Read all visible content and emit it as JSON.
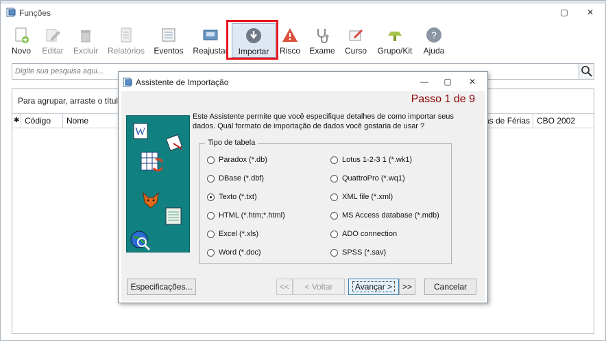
{
  "window": {
    "title": "Funções",
    "controls": [
      "▢",
      "✕"
    ]
  },
  "toolbar": {
    "buttons": [
      {
        "label": "Novo",
        "icon": "new-icon",
        "enabled": true
      },
      {
        "label": "Editar",
        "icon": "edit-icon",
        "enabled": false
      },
      {
        "label": "Excluir",
        "icon": "delete-icon",
        "enabled": false
      },
      {
        "label": "Relatórios",
        "icon": "report-icon",
        "enabled": false
      },
      {
        "label": "Eventos",
        "icon": "events-icon",
        "enabled": true
      },
      {
        "label": "Reajustar",
        "icon": "adjust-icon",
        "enabled": true
      },
      {
        "label": "Importar",
        "icon": "import-icon",
        "enabled": true,
        "active": true
      },
      {
        "label": "Risco",
        "icon": "warning-icon",
        "enabled": true
      },
      {
        "label": "Exame",
        "icon": "stethoscope-icon",
        "enabled": true
      },
      {
        "label": "Curso",
        "icon": "course-icon",
        "enabled": true
      },
      {
        "label": "Grupo/Kit",
        "icon": "group-icon",
        "enabled": true
      },
      {
        "label": "Ajuda",
        "icon": "help-icon",
        "enabled": true
      }
    ]
  },
  "search": {
    "placeholder": "Digite sua pesquisa aqui..."
  },
  "grid": {
    "group_hint": "Para agrupar, arraste o título",
    "columns": [
      "✱",
      "Código",
      "Nome",
      "as de Férias",
      "CBO 2002"
    ]
  },
  "dialog": {
    "title": "Assistente de Importação",
    "controls": [
      "—",
      "▢",
      "✕"
    ],
    "step": "Passo 1 de 9",
    "intro": "Este Assistente permite que você especifique detalhes de como importar seus dados. Qual formato de importação de dados você gostaria de usar ?",
    "group_title": "Tipo de tabela",
    "options_left": [
      {
        "label": "Paradox (*.db)",
        "checked": false
      },
      {
        "label": "DBase (*.dbf)",
        "checked": false
      },
      {
        "label": "Texto (*.txt)",
        "checked": true
      },
      {
        "label": "HTML (*.htm;*.html)",
        "checked": false
      },
      {
        "label": "Excel (*.xls)",
        "checked": false
      },
      {
        "label": "Word (*.doc)",
        "checked": false
      }
    ],
    "options_right": [
      {
        "label": "Lotus 1-2-3 1 (*.wk1)",
        "checked": false
      },
      {
        "label": "QuattroPro (*.wq1)",
        "checked": false
      },
      {
        "label": "XML file (*.xml)",
        "checked": false
      },
      {
        "label": "MS Access database (*.mdb)",
        "checked": false
      },
      {
        "label": "ADO connection",
        "checked": false
      },
      {
        "label": "SPSS (*.sav)",
        "checked": false
      }
    ],
    "buttons": {
      "specs": "Especificações...",
      "first": "<<",
      "back": "< Voltar",
      "next": "Avançar >",
      "last": ">>",
      "cancel": "Cancelar"
    }
  }
}
